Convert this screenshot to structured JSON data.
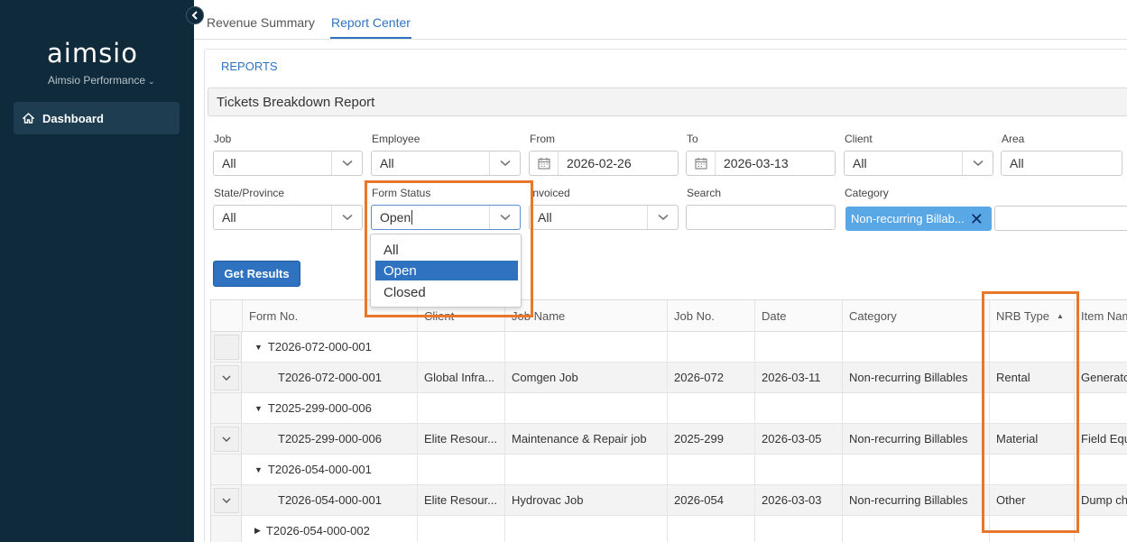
{
  "sidebar": {
    "logo": "aimsio",
    "org_name": "Aimsio Performance",
    "nav_dashboard": "Dashboard"
  },
  "tabs": [
    "Revenue Summary",
    "Report Center"
  ],
  "reports_link": "REPORTS",
  "report_title": "Tickets Breakdown Report",
  "filters": {
    "job": {
      "label": "Job",
      "value": "All"
    },
    "employee": {
      "label": "Employee",
      "value": "All"
    },
    "from": {
      "label": "From",
      "value": "2026-02-26"
    },
    "to": {
      "label": "To",
      "value": "2026-03-13"
    },
    "client": {
      "label": "Client",
      "value": "All"
    },
    "area": {
      "label": "Area",
      "value": "All"
    },
    "state": {
      "label": "State/Province",
      "value": "All"
    },
    "form_status": {
      "label": "Form Status",
      "value": "Open"
    },
    "invoiced": {
      "label": "Invoiced",
      "value": "All"
    },
    "search": {
      "label": "Search",
      "value": ""
    },
    "category": {
      "label": "Category",
      "chip": "Non-recurring Billab...",
      "chip_remove": "✕"
    }
  },
  "form_status_options": [
    "All",
    "Open",
    "Closed"
  ],
  "get_results": "Get Results",
  "table": {
    "headers": [
      "Form No.",
      "Client",
      "Job Name",
      "Job No.",
      "Date",
      "Category",
      "NRB Type",
      "Item Nam"
    ],
    "rows": [
      {
        "group": "T2026-072-000-001",
        "expanded": true
      },
      {
        "form": "T2026-072-000-001",
        "client": "Global Infra...",
        "job_name": "Comgen Job",
        "job_no": "2026-072",
        "date": "2026-03-11",
        "category": "Non-recurring Billables",
        "nrb": "Rental",
        "item": "Generato"
      },
      {
        "group": "T2025-299-000-006",
        "expanded": true
      },
      {
        "form": "T2025-299-000-006",
        "client": "Elite Resour...",
        "job_name": "Maintenance & Repair job",
        "job_no": "2025-299",
        "date": "2026-03-05",
        "category": "Non-recurring Billables",
        "nrb": "Material",
        "item": "Field Equ"
      },
      {
        "group": "T2026-054-000-001",
        "expanded": true
      },
      {
        "form": "T2026-054-000-001",
        "client": "Elite Resour...",
        "job_name": "Hydrovac Job",
        "job_no": "2026-054",
        "date": "2026-03-03",
        "category": "Non-recurring Billables",
        "nrb": "Other",
        "item": "Dump ch"
      },
      {
        "group": "T2026-054-000-002",
        "expanded": false
      }
    ]
  },
  "colors": {
    "sidebar": "#0f2a3a",
    "accent": "#2f73c0",
    "highlight": "#e8772e",
    "chip": "#5aa7e6"
  }
}
